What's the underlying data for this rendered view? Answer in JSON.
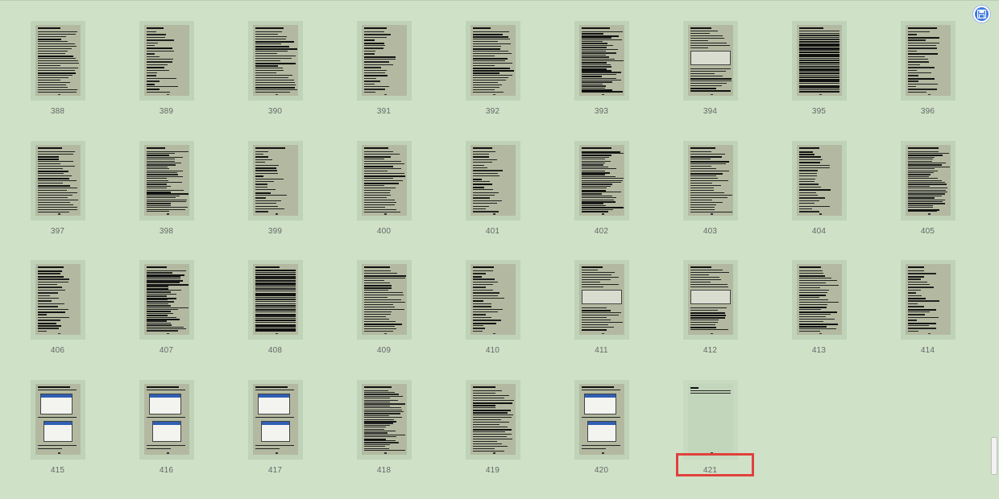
{
  "pages": [
    {
      "label": "388",
      "style": "text"
    },
    {
      "label": "389",
      "style": "list"
    },
    {
      "label": "390",
      "style": "text"
    },
    {
      "label": "391",
      "style": "list"
    },
    {
      "label": "392",
      "style": "text"
    },
    {
      "label": "393",
      "style": "dense"
    },
    {
      "label": "394",
      "style": "figure"
    },
    {
      "label": "395",
      "style": "table"
    },
    {
      "label": "396",
      "style": "list"
    },
    {
      "label": "397",
      "style": "text"
    },
    {
      "label": "398",
      "style": "dense"
    },
    {
      "label": "399",
      "style": "list"
    },
    {
      "label": "400",
      "style": "text"
    },
    {
      "label": "401",
      "style": "list"
    },
    {
      "label": "402",
      "style": "dense"
    },
    {
      "label": "403",
      "style": "text"
    },
    {
      "label": "404",
      "style": "list"
    },
    {
      "label": "405",
      "style": "dense"
    },
    {
      "label": "406",
      "style": "list"
    },
    {
      "label": "407",
      "style": "dense"
    },
    {
      "label": "408",
      "style": "table"
    },
    {
      "label": "409",
      "style": "text"
    },
    {
      "label": "410",
      "style": "list"
    },
    {
      "label": "411",
      "style": "figure"
    },
    {
      "label": "412",
      "style": "figure"
    },
    {
      "label": "413",
      "style": "text"
    },
    {
      "label": "414",
      "style": "list"
    },
    {
      "label": "415",
      "style": "screen"
    },
    {
      "label": "416",
      "style": "screen"
    },
    {
      "label": "417",
      "style": "screen"
    },
    {
      "label": "418",
      "style": "dense"
    },
    {
      "label": "419",
      "style": "text"
    },
    {
      "label": "420",
      "style": "screen"
    },
    {
      "label": "421",
      "style": "sparse"
    }
  ],
  "highlighted_page": "421",
  "fab_icon": "save-icon",
  "colors": {
    "background": "#cfe2c8",
    "highlight": "#e0413c",
    "fab": "#3f7be0"
  }
}
